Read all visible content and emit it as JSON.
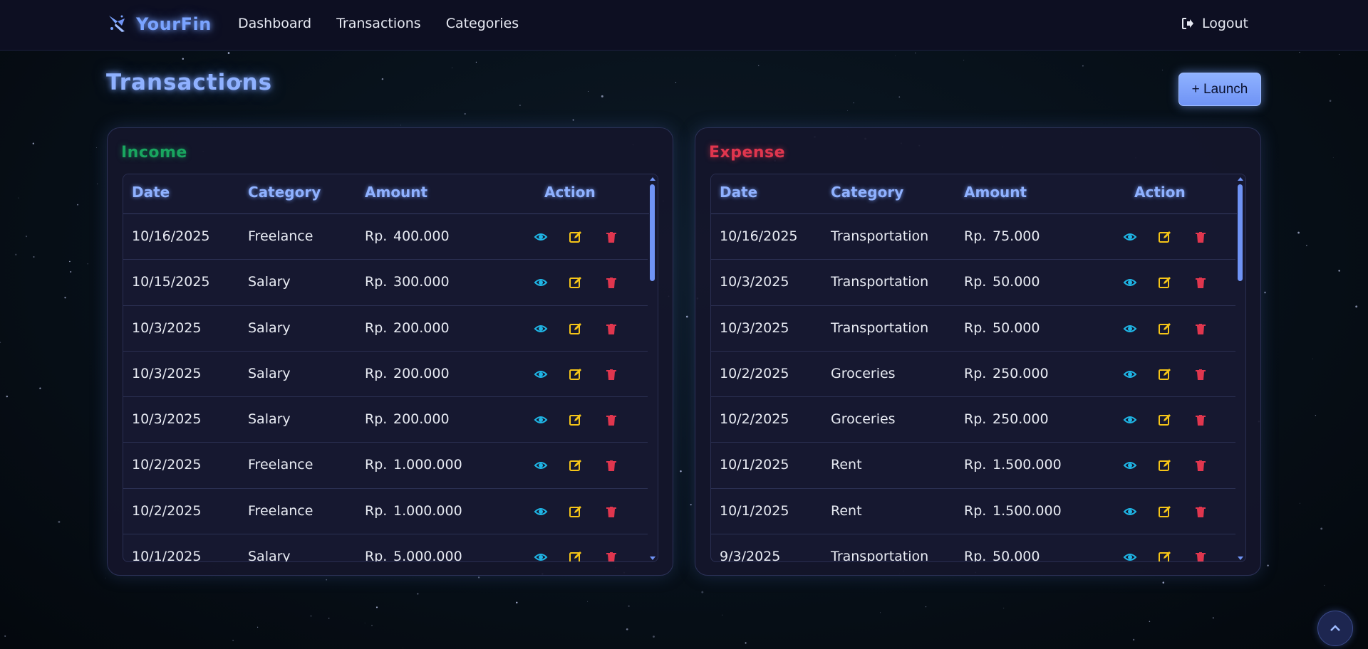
{
  "nav": {
    "brand": "YourFin",
    "links": [
      "Dashboard",
      "Transactions",
      "Categories"
    ],
    "logout": "Logout"
  },
  "page": {
    "title": "Transactions",
    "launch_button": "+ Launch"
  },
  "colors": {
    "accent": "#7aa3ff",
    "income": "#19a55f",
    "expense": "#e0364e",
    "view": "#1fb6e6",
    "edit": "#f5c518",
    "delete": "#e0364e"
  },
  "income": {
    "title": "Income",
    "headers": [
      "Date",
      "Category",
      "Amount",
      "Action"
    ],
    "rows": [
      {
        "date": "10/16/2025",
        "category": "Freelance",
        "currency": "Rp.",
        "amount": "400.000"
      },
      {
        "date": "10/15/2025",
        "category": "Salary",
        "currency": "Rp.",
        "amount": "300.000"
      },
      {
        "date": "10/3/2025",
        "category": "Salary",
        "currency": "Rp.",
        "amount": "200.000"
      },
      {
        "date": "10/3/2025",
        "category": "Salary",
        "currency": "Rp.",
        "amount": "200.000"
      },
      {
        "date": "10/3/2025",
        "category": "Salary",
        "currency": "Rp.",
        "amount": "200.000"
      },
      {
        "date": "10/2/2025",
        "category": "Freelance",
        "currency": "Rp.",
        "amount": "1.000.000"
      },
      {
        "date": "10/2/2025",
        "category": "Freelance",
        "currency": "Rp.",
        "amount": "1.000.000"
      },
      {
        "date": "10/1/2025",
        "category": "Salary",
        "currency": "Rp.",
        "amount": "5.000.000"
      }
    ]
  },
  "expense": {
    "title": "Expense",
    "headers": [
      "Date",
      "Category",
      "Amount",
      "Action"
    ],
    "rows": [
      {
        "date": "10/16/2025",
        "category": "Transportation",
        "currency": "Rp.",
        "amount": "75.000"
      },
      {
        "date": "10/3/2025",
        "category": "Transportation",
        "currency": "Rp.",
        "amount": "50.000"
      },
      {
        "date": "10/3/2025",
        "category": "Transportation",
        "currency": "Rp.",
        "amount": "50.000"
      },
      {
        "date": "10/2/2025",
        "category": "Groceries",
        "currency": "Rp.",
        "amount": "250.000"
      },
      {
        "date": "10/2/2025",
        "category": "Groceries",
        "currency": "Rp.",
        "amount": "250.000"
      },
      {
        "date": "10/1/2025",
        "category": "Rent",
        "currency": "Rp.",
        "amount": "1.500.000"
      },
      {
        "date": "10/1/2025",
        "category": "Rent",
        "currency": "Rp.",
        "amount": "1.500.000"
      },
      {
        "date": "9/3/2025",
        "category": "Transportation",
        "currency": "Rp.",
        "amount": "50.000"
      }
    ]
  },
  "icons": {
    "brand": "rocket-icon",
    "logout": "logout-icon",
    "view": "eye-icon",
    "edit": "edit-icon",
    "delete": "trash-icon",
    "to_top": "chevron-up-icon"
  }
}
